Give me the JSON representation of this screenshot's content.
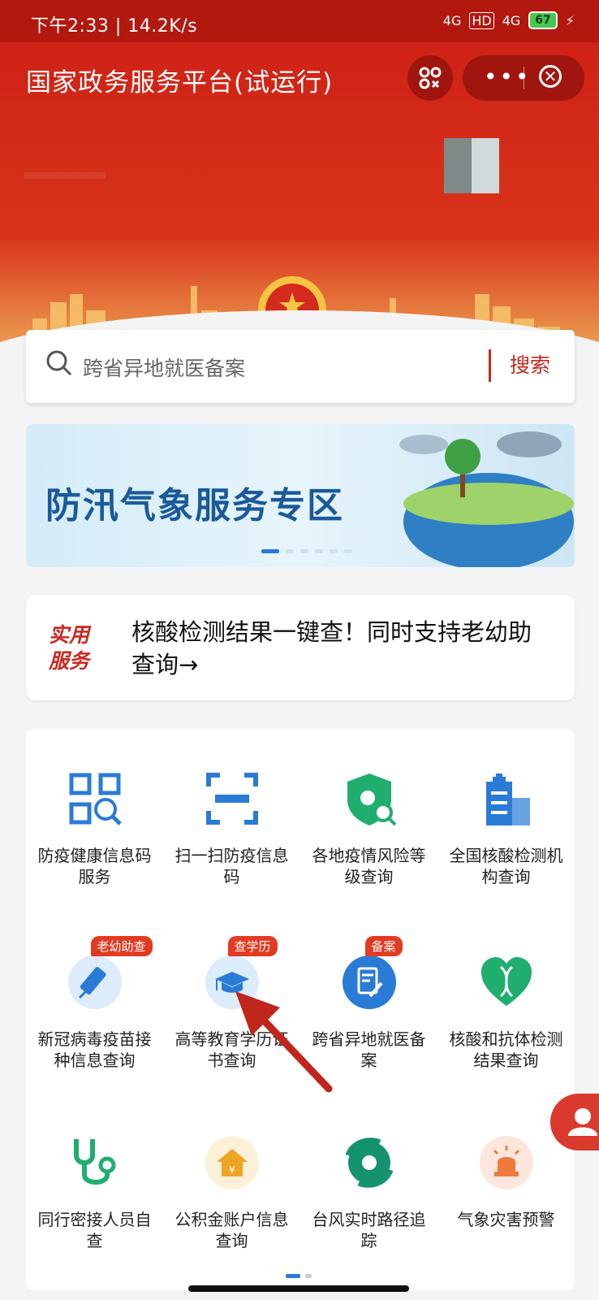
{
  "status_bar": {
    "time_speed": "下午2:33 | 14.2K/s",
    "network1": "4G",
    "hd": "HD",
    "network2": "4G",
    "battery": "67"
  },
  "header": {
    "title": "国家政务服务平台(试运行)"
  },
  "search": {
    "placeholder": "跨省异地就医备案",
    "button": "搜索"
  },
  "banner": {
    "text": "防汛气象服务专区"
  },
  "notice": {
    "tag": "实用服务",
    "message": "核酸检测结果一键查！同时支持老幼助查询→"
  },
  "services": [
    {
      "label": "防疫健康信息码服务",
      "icon": "qr-scan-icon",
      "badge": ""
    },
    {
      "label": "扫一扫防疫信息码",
      "icon": "scan-frame-icon",
      "badge": ""
    },
    {
      "label": "各地疫情风险等级查询",
      "icon": "virus-shield-icon",
      "badge": ""
    },
    {
      "label": "全国核酸检测机构查询",
      "icon": "hospital-icon",
      "badge": ""
    },
    {
      "label": "新冠病毒疫苗接种信息查询",
      "icon": "vaccine-icon",
      "badge": "老幼助查"
    },
    {
      "label": "高等教育学历证书查询",
      "icon": "graduation-cap-icon",
      "badge": "查学历"
    },
    {
      "label": "跨省异地就医备案",
      "icon": "edit-document-icon",
      "badge": "备案"
    },
    {
      "label": "核酸和抗体检测结果查询",
      "icon": "dna-heart-icon",
      "badge": ""
    },
    {
      "label": "同行密接人员自查",
      "icon": "stethoscope-icon",
      "badge": ""
    },
    {
      "label": "公积金账户信息查询",
      "icon": "house-fund-icon",
      "badge": ""
    },
    {
      "label": "台风实时路径追踪",
      "icon": "typhoon-icon",
      "badge": ""
    },
    {
      "label": "气象灾害预警",
      "icon": "alarm-light-icon",
      "badge": ""
    }
  ],
  "colors": {
    "brand_red": "#c5281c",
    "blue": "#2a7bd6",
    "green": "#1fae6e"
  }
}
